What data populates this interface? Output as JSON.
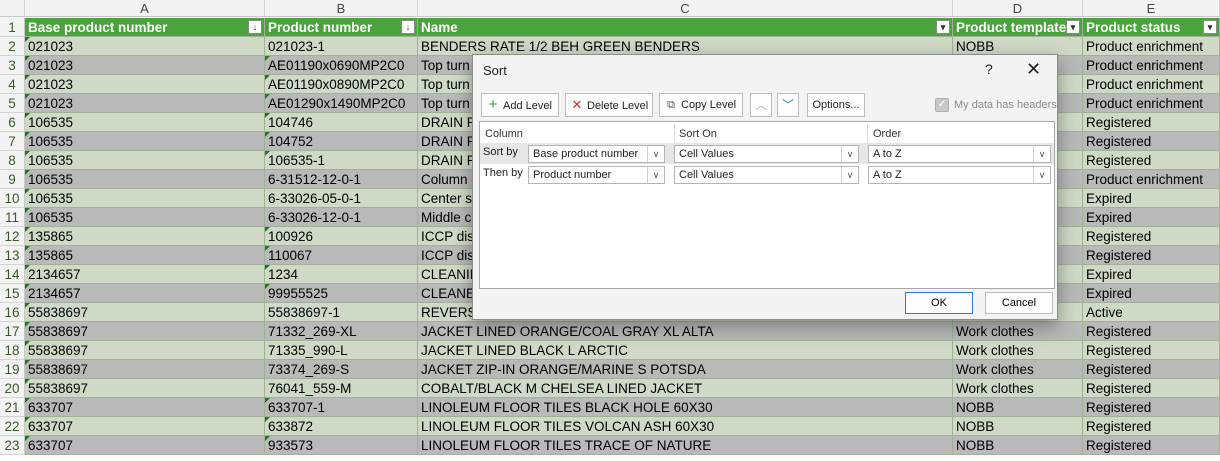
{
  "columns": [
    "A",
    "B",
    "C",
    "D",
    "E"
  ],
  "headers": [
    "Base product number",
    "Product number",
    "Name",
    "Product template",
    "Product status"
  ],
  "rows": [
    {
      "n": "2",
      "a": "021023",
      "b": "021023-1",
      "c": "BENDERS RATE 1/2 BEH GREEN BENDERS",
      "d": "NOBB",
      "e": "Product enrichment"
    },
    {
      "n": "3",
      "a": "021023",
      "b": "AE01190x0690MP2C0",
      "c": "Top turn",
      "d": "",
      "e": "Product enrichment"
    },
    {
      "n": "4",
      "a": "021023",
      "b": "AE01190x0890MP2C0",
      "c": "Top turn",
      "d": "",
      "e": "Product enrichment"
    },
    {
      "n": "5",
      "a": "021023",
      "b": "AE01290x1490MP2C0",
      "c": "Top turn",
      "d": "",
      "e": "Product enrichment"
    },
    {
      "n": "6",
      "a": "106535",
      "b": "104746",
      "c": "DRAIN P",
      "d": "",
      "e": "Registered"
    },
    {
      "n": "7",
      "a": "106535",
      "b": "104752",
      "c": "DRAIN P",
      "d": "",
      "e": "Registered"
    },
    {
      "n": "8",
      "a": "106535",
      "b": "106535-1",
      "c": "DRAIN P",
      "d": "",
      "e": "Registered"
    },
    {
      "n": "9",
      "a": "106535",
      "b": "6-31512-12-0-1",
      "c": "Column",
      "d": "",
      "e": "Product enrichment"
    },
    {
      "n": "10",
      "a": "106535",
      "b": "6-33026-05-0-1",
      "c": "Center s",
      "d": "",
      "e": "Expired"
    },
    {
      "n": "11",
      "a": "106535",
      "b": "6-33026-12-0-1",
      "c": "Middle c",
      "d": "",
      "e": "Expired"
    },
    {
      "n": "12",
      "a": "135865",
      "b": "100926",
      "c": "ICCP dis",
      "d": "",
      "e": "Registered"
    },
    {
      "n": "13",
      "a": "135865",
      "b": "110067",
      "c": "ICCP dis",
      "d": "",
      "e": "Registered"
    },
    {
      "n": "14",
      "a": "2134657",
      "b": "1234",
      "c": "CLEANIN",
      "d": "",
      "e": "Expired"
    },
    {
      "n": "15",
      "a": "2134657",
      "b": "99955525",
      "c": "CLEANER",
      "d": "",
      "e": "Expired"
    },
    {
      "n": "16",
      "a": "55838697",
      "b": "55838697-1",
      "c": "REVERSIL",
      "d": "",
      "e": "Active"
    },
    {
      "n": "17",
      "a": "55838697",
      "b": "71332_269-XL",
      "c": "JACKET LINED ORANGE/COAL GRAY XL ALTA",
      "d": "Work clothes",
      "e": "Registered"
    },
    {
      "n": "18",
      "a": "55838697",
      "b": "71335_990-L",
      "c": "JACKET LINED BLACK L ARCTIC",
      "d": "Work clothes",
      "e": "Registered"
    },
    {
      "n": "19",
      "a": "55838697",
      "b": "73374_269-S",
      "c": "JACKET ZIP-IN ORANGE/MARINE S POTSDA",
      "d": "Work clothes",
      "e": "Registered"
    },
    {
      "n": "20",
      "a": "55838697",
      "b": "76041_559-M",
      "c": "COBALT/BLACK M CHELSEA LINED JACKET",
      "d": "Work clothes",
      "e": "Registered"
    },
    {
      "n": "21",
      "a": "633707",
      "b": "633707-1",
      "c": "LINOLEUM FLOOR TILES BLACK HOLE 60X30",
      "d": "NOBB",
      "e": "Registered"
    },
    {
      "n": "22",
      "a": "633707",
      "b": "633872",
      "c": "LINOLEUM FLOOR TILES VOLCAN ASH 60X30",
      "d": "NOBB",
      "e": "Registered"
    },
    {
      "n": "23",
      "a": "633707",
      "b": "933573",
      "c": "LINOLEUM FLOOR TILES TRACE OF NATURE",
      "d": "NOBB",
      "e": "Registered"
    }
  ],
  "dialog": {
    "title": "Sort",
    "help": "?",
    "close": "✕",
    "add_level": "Add Level",
    "delete_level": "Delete Level",
    "copy_level": "Copy Level",
    "options": "Options...",
    "my_data_headers": "My data has headers",
    "col_column": "Column",
    "col_sort_on": "Sort On",
    "col_order": "Order",
    "levels": [
      {
        "label": "Sort by",
        "column": "Base product number",
        "sort_on": "Cell Values",
        "order": "A to Z"
      },
      {
        "label": "Then by",
        "column": "Product number",
        "sort_on": "Cell Values",
        "order": "A to Z"
      }
    ],
    "ok": "OK",
    "cancel": "Cancel"
  },
  "colors": {
    "header_green": "#4aa33c",
    "band_green": "#cfd9c6",
    "band_gray": "#b9b9b9"
  }
}
